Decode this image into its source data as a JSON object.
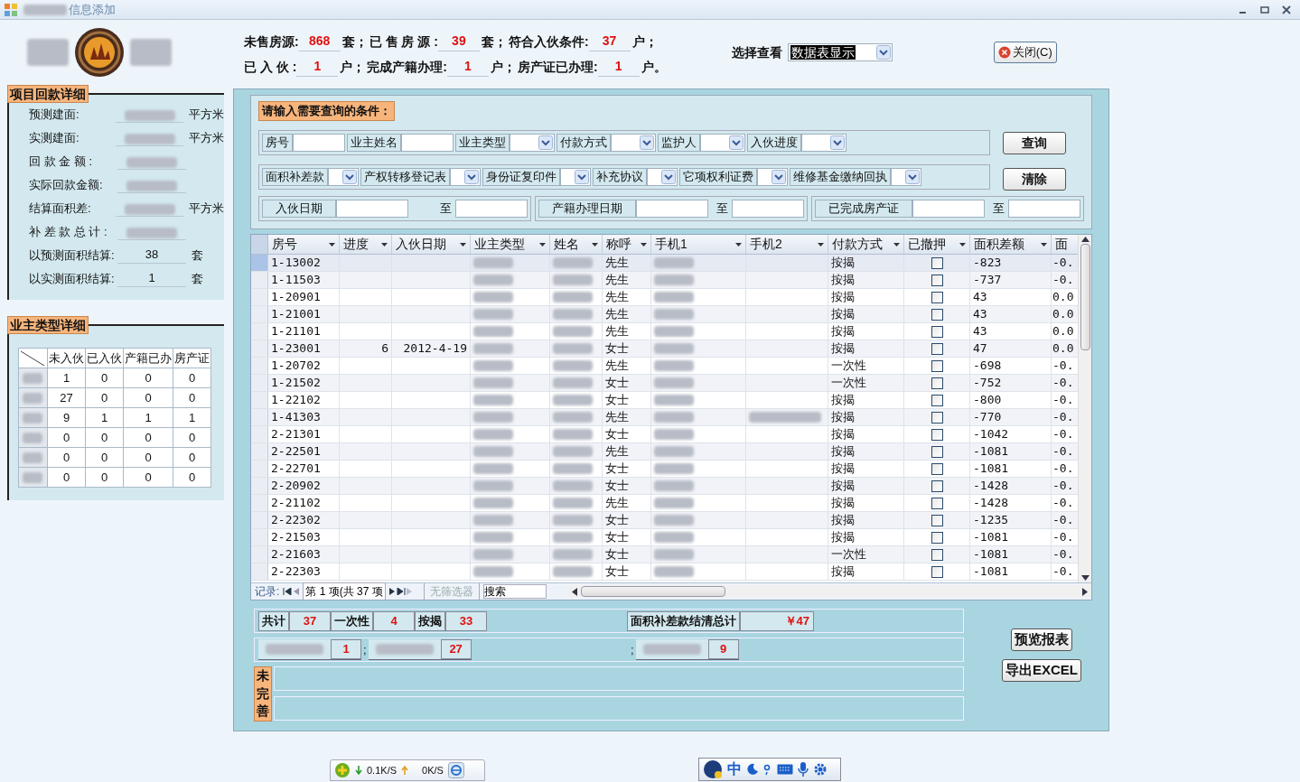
{
  "window": {
    "title": "信息添加"
  },
  "stats": [
    [
      {
        "label": "未售房源:",
        "value": "868",
        "unit": "套；"
      },
      {
        "label": "已 售 房 源 :",
        "value": "39",
        "unit": "套；"
      },
      {
        "label": "符合入伙条件:",
        "value": "37",
        "unit": "户；"
      }
    ],
    [
      {
        "label": "已 入 伙 :",
        "value": "1",
        "unit": "户；"
      },
      {
        "label": "完成产籍办理:",
        "value": "1",
        "unit": "户；"
      },
      {
        "label": "房产证已办理:",
        "value": "1",
        "unit": "户。"
      }
    ]
  ],
  "view_select": {
    "label": "选择查看",
    "value": "数据表显示"
  },
  "close_button": "关闭(C)",
  "project_payment": {
    "title": "项目回款详细",
    "rows": [
      {
        "label": "预测建面:",
        "kind": "blurred",
        "unit": "平方米"
      },
      {
        "label": "实测建面:",
        "kind": "blurred",
        "unit": "平方米"
      },
      {
        "label": "回 款 金 额 :",
        "kind": "blurred"
      },
      {
        "label": "实际回款金额:",
        "kind": "blurred"
      },
      {
        "label": "结算面积差:",
        "kind": "blurred",
        "unit": "平方米"
      },
      {
        "label": "补 差 款 总 计 :",
        "kind": "blurred"
      },
      {
        "label": "以预测面积结算:",
        "kind": "value",
        "value": "38",
        "unit": "套"
      },
      {
        "label": "以实测面积结算:",
        "kind": "value",
        "value": "1",
        "unit": "套"
      }
    ]
  },
  "owner_types": {
    "title": "业主类型详细",
    "columns": [
      "未入伙",
      "已入伙",
      "产籍已办",
      "房产证"
    ],
    "rows": [
      [
        "1",
        "0",
        "0",
        "0"
      ],
      [
        "27",
        "0",
        "0",
        "0"
      ],
      [
        "9",
        "1",
        "1",
        "1"
      ],
      [
        "0",
        "0",
        "0",
        "0"
      ],
      [
        "0",
        "0",
        "0",
        "0"
      ],
      [
        "0",
        "0",
        "0",
        "0"
      ]
    ]
  },
  "query": {
    "title": "请输入需要查询的条件：",
    "row_1": [
      {
        "label": "房号",
        "kind": "text"
      },
      {
        "label": "业主姓名",
        "kind": "text"
      },
      {
        "label": "业主类型",
        "kind": "select"
      },
      {
        "label": "付款方式",
        "kind": "select"
      },
      {
        "label": "监护人",
        "kind": "select"
      },
      {
        "label": "入伙进度",
        "kind": "select"
      }
    ],
    "row_2": [
      {
        "label": "面积补差款",
        "kind": "select"
      },
      {
        "label": "产权转移登记表",
        "kind": "select"
      },
      {
        "label": "身份证复印件",
        "kind": "select"
      },
      {
        "label": "补充协议",
        "kind": "select"
      },
      {
        "label": "它项权利证费",
        "kind": "select"
      },
      {
        "label": "维修基金缴纳回执",
        "kind": "select"
      }
    ],
    "date_ranges": [
      {
        "label": "入伙日期",
        "to": "至"
      },
      {
        "label": "产籍办理日期",
        "to": "至"
      },
      {
        "label": "已完成房产证",
        "to": "至"
      }
    ],
    "buttons": [
      "查询",
      "清除"
    ]
  },
  "table": {
    "columns": [
      {
        "label": "房号",
        "kind": "text"
      },
      {
        "label": "进度",
        "kind": "text"
      },
      {
        "label": "入伙日期",
        "kind": "text"
      },
      {
        "label": "业主类型",
        "kind": "blurred"
      },
      {
        "label": "姓名",
        "kind": "blurred"
      },
      {
        "label": "称呼",
        "kind": "text"
      },
      {
        "label": "手机1",
        "kind": "blurred"
      },
      {
        "label": "手机2",
        "kind": "text"
      },
      {
        "label": "付款方式",
        "kind": "text"
      },
      {
        "label": "已撤押",
        "kind": "check"
      },
      {
        "label": "面积差额",
        "kind": "text"
      },
      {
        "label": "面",
        "kind": "text"
      }
    ],
    "rows": [
      {
        "selected": true,
        "room": "1-13002",
        "title": "先生",
        "payment": "按揭",
        "deposit_returned": false,
        "area_diff": "-823",
        "column_12": "-0."
      },
      {
        "selected": false,
        "room": "1-11503",
        "title": "先生",
        "payment": "按揭",
        "deposit_returned": false,
        "area_diff": "-737",
        "column_12": "-0."
      },
      {
        "selected": false,
        "room": "1-20901",
        "title": "先生",
        "payment": "按揭",
        "deposit_returned": false,
        "area_diff": "43",
        "column_12": "0.0"
      },
      {
        "selected": false,
        "room": "1-21001",
        "title": "先生",
        "payment": "按揭",
        "deposit_returned": false,
        "area_diff": "43",
        "column_12": "0.0"
      },
      {
        "selected": false,
        "room": "1-21101",
        "title": "先生",
        "payment": "按揭",
        "deposit_returned": false,
        "area_diff": "43",
        "column_12": "0.0"
      },
      {
        "selected": false,
        "room": "1-23001",
        "progress": "6",
        "date": "2012-4-19",
        "title": "女士",
        "payment": "按揭",
        "deposit_returned": false,
        "area_diff": "47",
        "column_12": "0.0"
      },
      {
        "selected": false,
        "room": "1-20702",
        "title": "先生",
        "payment": "一次性",
        "deposit_returned": false,
        "area_diff": "-698",
        "column_12": "-0."
      },
      {
        "selected": false,
        "room": "1-21502",
        "title": "女士",
        "payment": "一次性",
        "deposit_returned": false,
        "area_diff": "-752",
        "column_12": "-0."
      },
      {
        "selected": false,
        "room": "1-22102",
        "title": "女士",
        "payment": "按揭",
        "deposit_returned": false,
        "area_diff": "-800",
        "column_12": "-0."
      },
      {
        "selected": false,
        "room": "1-41303",
        "title": "先生",
        "phone2_blurred": true,
        "payment": "按揭",
        "deposit_returned": false,
        "area_diff": "-770",
        "column_12": "-0."
      },
      {
        "selected": false,
        "room": "2-21301",
        "title": "女士",
        "payment": "按揭",
        "deposit_returned": false,
        "area_diff": "-1042",
        "column_12": "-0."
      },
      {
        "selected": false,
        "room": "2-22501",
        "title": "先生",
        "payment": "按揭",
        "deposit_returned": false,
        "area_diff": "-1081",
        "column_12": "-0."
      },
      {
        "selected": false,
        "room": "2-22701",
        "title": "女士",
        "payment": "按揭",
        "deposit_returned": false,
        "area_diff": "-1081",
        "column_12": "-0."
      },
      {
        "selected": false,
        "room": "2-20902",
        "title": "女士",
        "payment": "按揭",
        "deposit_returned": false,
        "area_diff": "-1428",
        "column_12": "-0."
      },
      {
        "selected": false,
        "room": "2-21102",
        "title": "先生",
        "payment": "按揭",
        "deposit_returned": false,
        "area_diff": "-1428",
        "column_12": "-0."
      },
      {
        "selected": false,
        "room": "2-22302",
        "title": "女士",
        "payment": "按揭",
        "deposit_returned": false,
        "area_diff": "-1235",
        "column_12": "-0."
      },
      {
        "selected": false,
        "room": "2-21503",
        "title": "女士",
        "payment": "按揭",
        "deposit_returned": false,
        "area_diff": "-1081",
        "column_12": "-0."
      },
      {
        "selected": false,
        "room": "2-21603",
        "title": "女士",
        "payment": "一次性",
        "deposit_returned": false,
        "area_diff": "-1081",
        "column_12": "-0."
      },
      {
        "selected": false,
        "room": "2-22303",
        "title": "女士",
        "payment": "按揭",
        "deposit_returned": false,
        "area_diff": "-1081",
        "column_12": "-0."
      }
    ],
    "navigator": {
      "label": "记录:",
      "position": "第 1 项(共 37 项",
      "filter": "无筛选器",
      "search": "搜索"
    }
  },
  "summary": {
    "counts": [
      {
        "label": "共计",
        "value": "37"
      },
      {
        "label": "一次性",
        "value": "4"
      },
      {
        "label": "按揭",
        "value": "33"
      }
    ],
    "total": {
      "label": "面积补差款结清总计",
      "value": "￥47"
    },
    "owner_counts": [
      {
        "value": "1"
      },
      {
        "separator": ";",
        "value": "27"
      },
      {
        "separator": ";",
        "value": "9"
      }
    ],
    "incomplete_label": "未完善"
  },
  "side_buttons": [
    "预览报表",
    "导出EXCEL"
  ],
  "net_speed": {
    "down": "0.1K/S",
    "up": "0K/S"
  },
  "ime_bar": {
    "mode": "中"
  }
}
